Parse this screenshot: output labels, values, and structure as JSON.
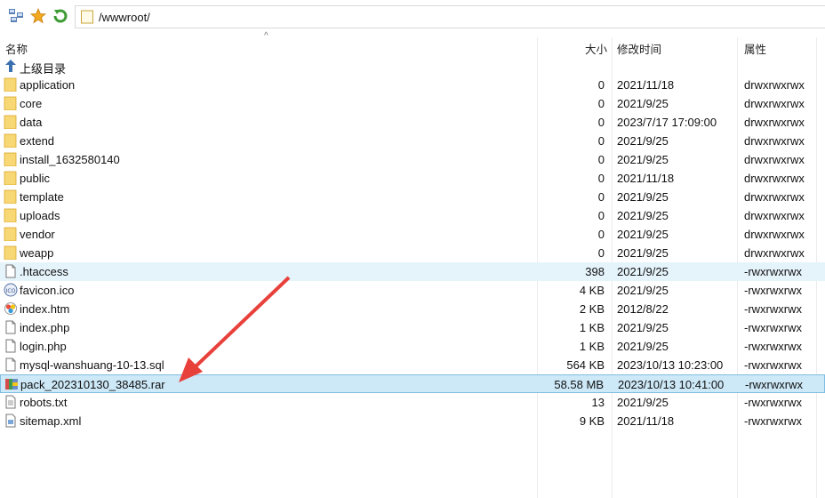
{
  "toolbar": {
    "path": "/wwwroot/"
  },
  "columns": {
    "name": "名称",
    "size": "大小",
    "modified": "修改时间",
    "attributes": "属性"
  },
  "parent_label": "上级目录",
  "files": [
    {
      "name": "application",
      "size": "0",
      "date": "2021/11/18",
      "perm": "drwxrwxrwx",
      "icon": "folder-icon"
    },
    {
      "name": "core",
      "size": "0",
      "date": "2021/9/25",
      "perm": "drwxrwxrwx",
      "icon": "folder-icon"
    },
    {
      "name": "data",
      "size": "0",
      "date": "2023/7/17 17:09:00",
      "perm": "drwxrwxrwx",
      "icon": "folder-icon"
    },
    {
      "name": "extend",
      "size": "0",
      "date": "2021/9/25",
      "perm": "drwxrwxrwx",
      "icon": "folder-icon"
    },
    {
      "name": "install_1632580140",
      "size": "0",
      "date": "2021/9/25",
      "perm": "drwxrwxrwx",
      "icon": "folder-icon"
    },
    {
      "name": "public",
      "size": "0",
      "date": "2021/11/18",
      "perm": "drwxrwxrwx",
      "icon": "folder-icon"
    },
    {
      "name": "template",
      "size": "0",
      "date": "2021/9/25",
      "perm": "drwxrwxrwx",
      "icon": "folder-icon"
    },
    {
      "name": "uploads",
      "size": "0",
      "date": "2021/9/25",
      "perm": "drwxrwxrwx",
      "icon": "folder-icon"
    },
    {
      "name": "vendor",
      "size": "0",
      "date": "2021/9/25",
      "perm": "drwxrwxrwx",
      "icon": "folder-icon"
    },
    {
      "name": "weapp",
      "size": "0",
      "date": "2021/9/25",
      "perm": "drwxrwxrwx",
      "icon": "folder-icon"
    },
    {
      "name": ".htaccess",
      "size": "398",
      "date": "2021/9/25",
      "perm": "-rwxrwxrwx",
      "icon": "file-icon"
    },
    {
      "name": "favicon.ico",
      "size": "4 KB",
      "date": "2021/9/25",
      "perm": "-rwxrwxrwx",
      "icon": "ico-file-icon"
    },
    {
      "name": "index.htm",
      "size": "2 KB",
      "date": "2012/8/22",
      "perm": "-rwxrwxrwx",
      "icon": "html-file-icon"
    },
    {
      "name": "index.php",
      "size": "1 KB",
      "date": "2021/9/25",
      "perm": "-rwxrwxrwx",
      "icon": "file-icon"
    },
    {
      "name": "login.php",
      "size": "1 KB",
      "date": "2021/9/25",
      "perm": "-rwxrwxrwx",
      "icon": "file-icon"
    },
    {
      "name": "mysql-wanshuang-10-13.sql",
      "size": "564 KB",
      "date": "2023/10/13 10:23:00",
      "perm": "-rwxrwxrwx",
      "icon": "file-icon"
    },
    {
      "name": "pack_202310130_38485.rar",
      "size": "58.58 MB",
      "date": "2023/10/13 10:41:00",
      "perm": "-rwxrwxrwx",
      "icon": "rar-archive-icon"
    },
    {
      "name": "robots.txt",
      "size": "13",
      "date": "2021/9/25",
      "perm": "-rwxrwxrwx",
      "icon": "text-file-icon"
    },
    {
      "name": "sitemap.xml",
      "size": "9 KB",
      "date": "2021/11/18",
      "perm": "-rwxrwxrwx",
      "icon": "xml-file-icon"
    }
  ],
  "state": {
    "hover_row": ".htaccess",
    "selected_row": "pack_202310130_38485.rar"
  },
  "colors": {
    "hover": "#e5f3fb",
    "selected": "#cde8f7",
    "arrow": "#e8413b",
    "folder": "#f8d775"
  }
}
